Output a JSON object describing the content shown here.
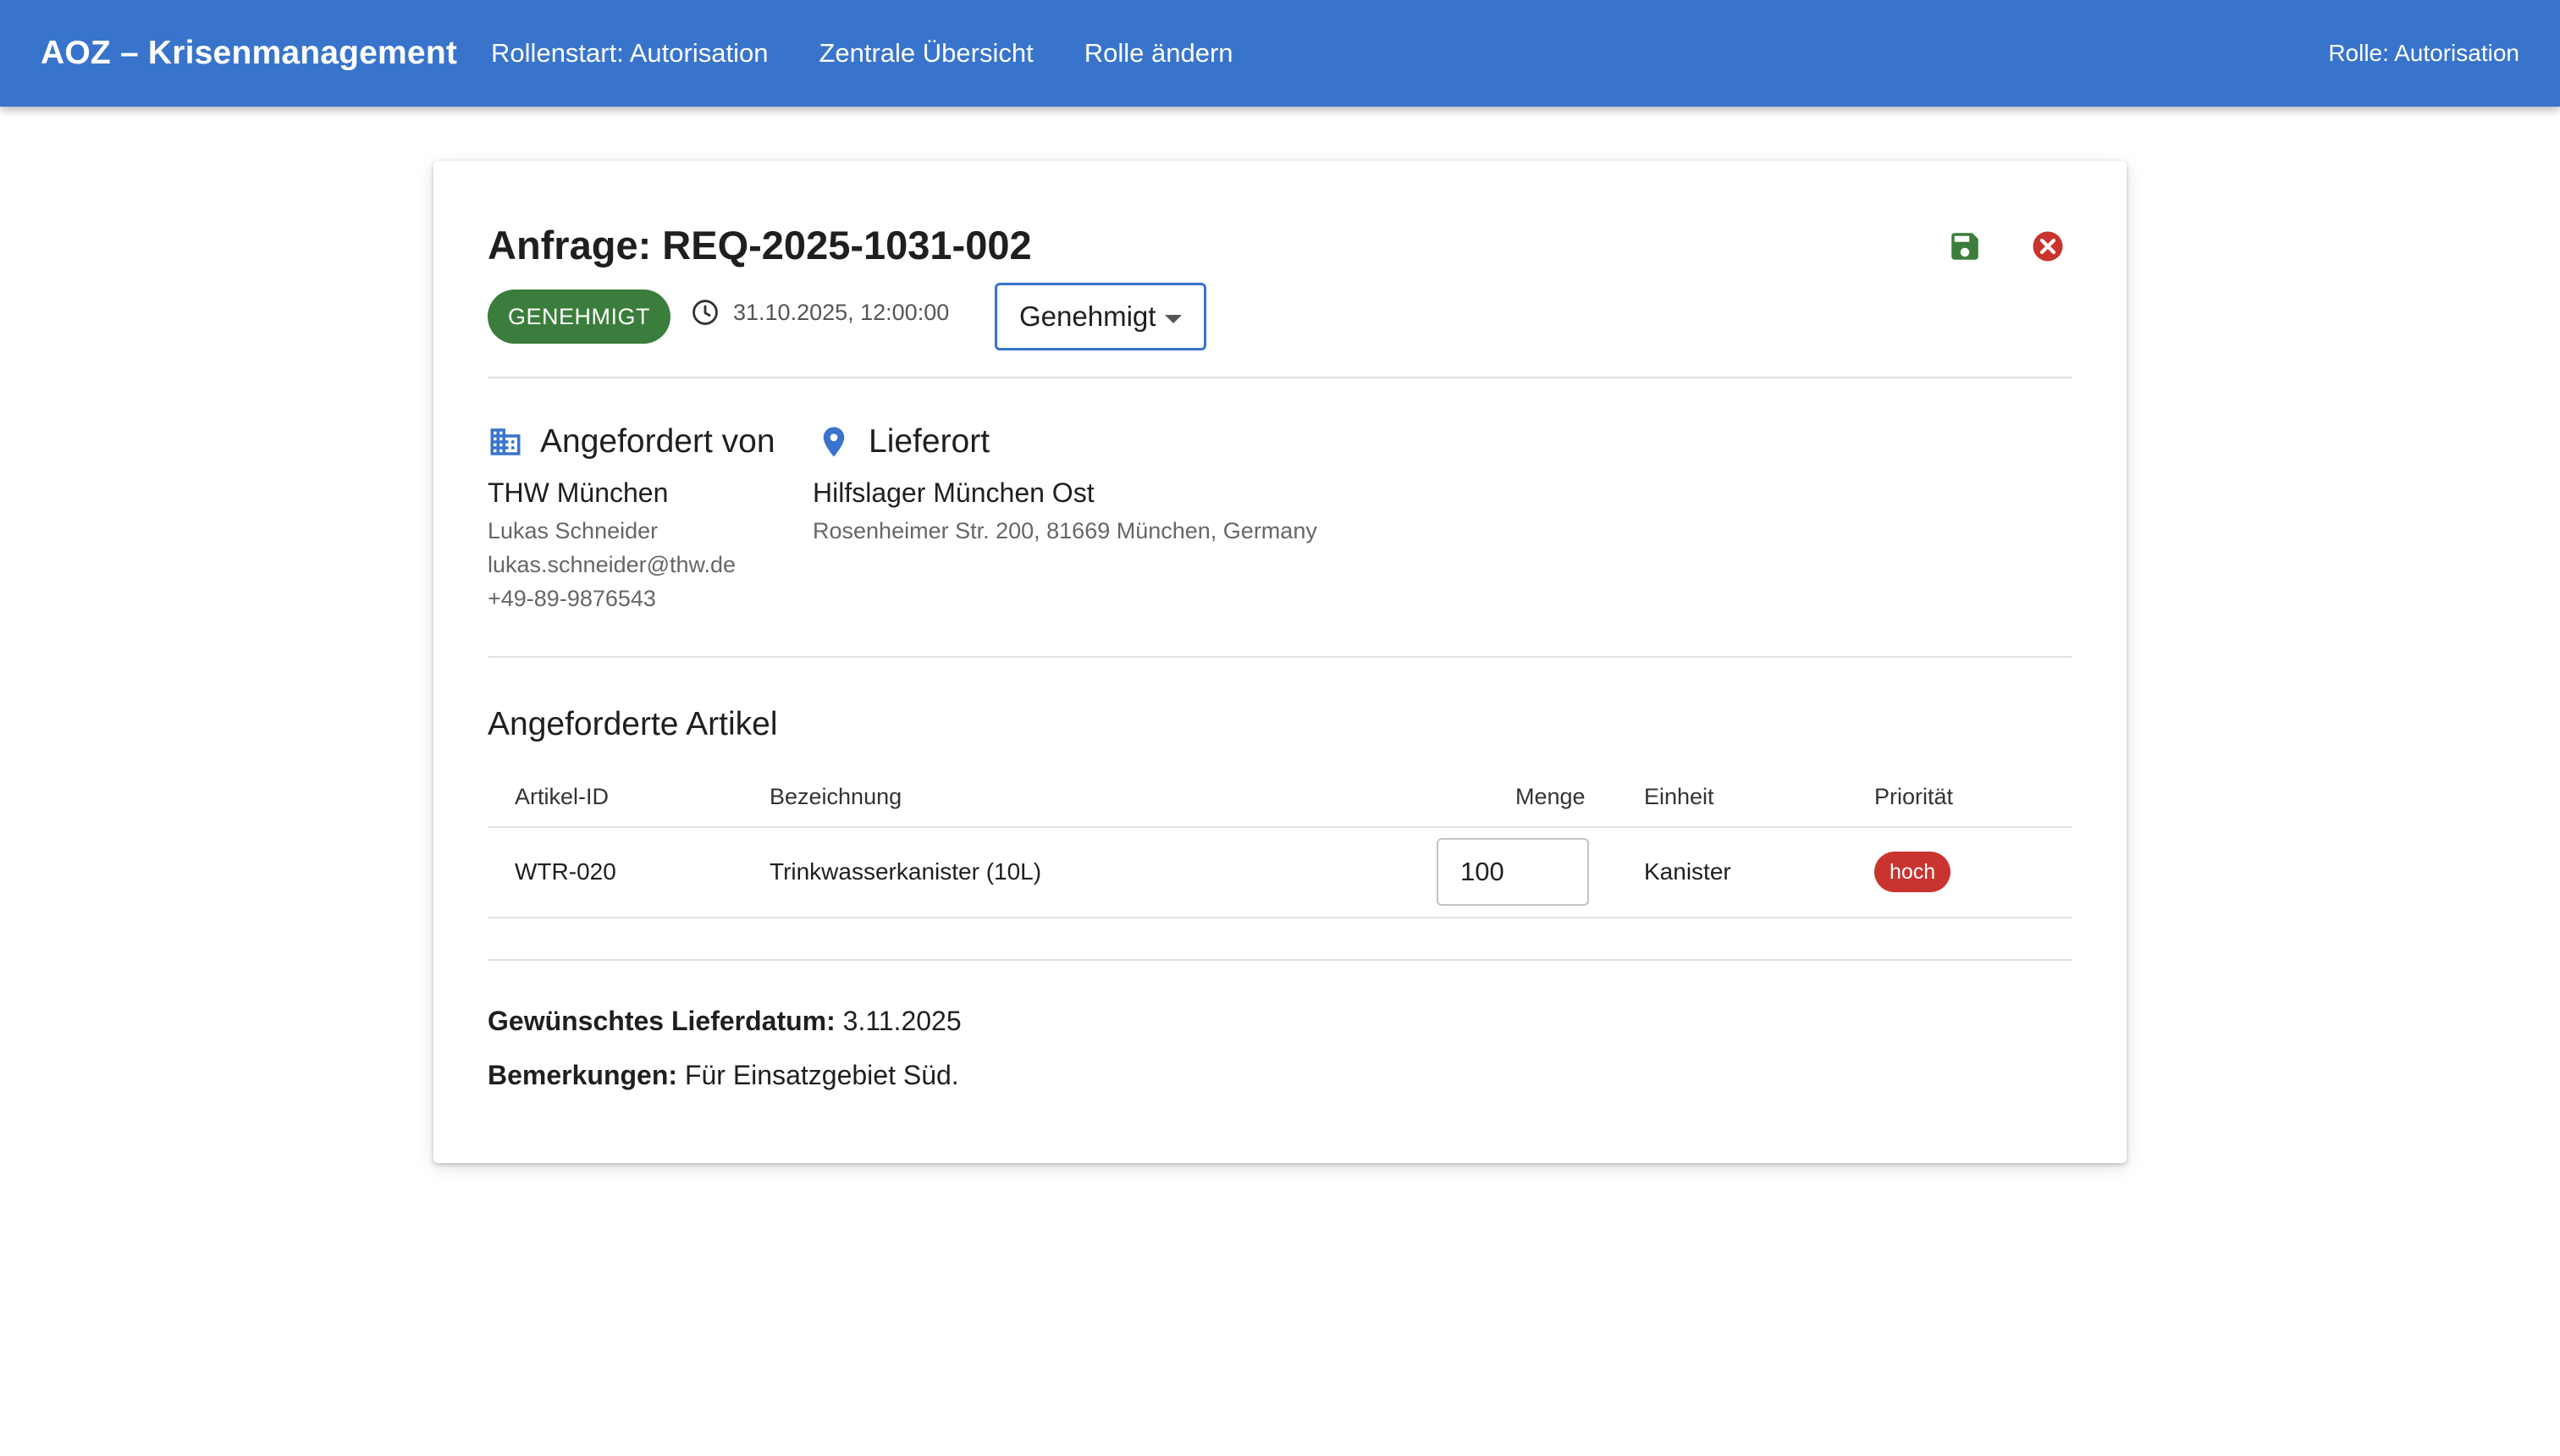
{
  "appbar": {
    "brand": "AOZ – Krisenmanagement",
    "nav": [
      "Rollenstart: Autorisation",
      "Zentrale Übersicht",
      "Rolle ändern"
    ],
    "role": "Rolle: Autorisation",
    "color": "#3874cb"
  },
  "request": {
    "title": "Anfrage: REQ-2025-1031-002",
    "status_chip": "GENEHMIGT",
    "datetime": "31.10.2025, 12:00:00",
    "status_select": "Genehmigt",
    "icons": {
      "save": "save-icon",
      "cancel": "cancel-circle-icon",
      "clock": "clock-icon",
      "building": "building-icon",
      "location": "location-pin-icon"
    },
    "colors": {
      "approved": "#3b7d3c",
      "priority_high": "#c9342f",
      "accent": "#3874cb"
    }
  },
  "requester": {
    "heading": "Angefordert von",
    "org": "THW München",
    "contact": "Lukas Schneider",
    "email": "lukas.schneider@thw.de",
    "phone": "+49-89-9876543"
  },
  "delivery": {
    "heading": "Lieferort",
    "name": "Hilfslager München Ost",
    "address": "Rosenheimer Str. 200, 81669 München, Germany"
  },
  "items": {
    "title": "Angeforderte Artikel",
    "columns": [
      "Artikel-ID",
      "Bezeichnung",
      "Menge",
      "Einheit",
      "Priorität"
    ],
    "rows": [
      {
        "id": "WTR-020",
        "name": "Trinkwasserkanister (10L)",
        "qty": "100",
        "unit": "Kanister",
        "priority": "hoch"
      }
    ]
  },
  "details": {
    "delivery_date_label": "Gewünschtes Lieferdatum:",
    "delivery_date": "3.11.2025",
    "remarks_label": "Bemerkungen:",
    "remarks": "Für Einsatzgebiet Süd."
  }
}
